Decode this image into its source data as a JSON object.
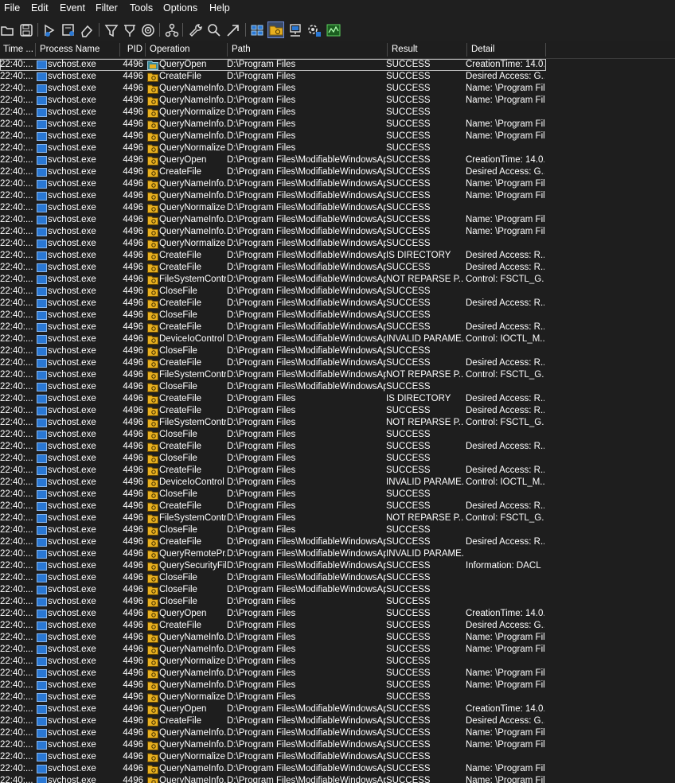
{
  "menu": [
    "File",
    "Edit",
    "Event",
    "Filter",
    "Tools",
    "Options",
    "Help"
  ],
  "toolbar_icons": [
    "open-icon",
    "save-icon",
    "capture-icon",
    "autoscroll-icon",
    "clear-icon",
    "filter-icon",
    "highlight-icon",
    "target-icon",
    "process-tree-icon",
    "find-icon",
    "search-icon",
    "jump-icon",
    "registry-icon",
    "filesystem-icon",
    "network-icon",
    "process-thread-icon",
    "profiling-icon"
  ],
  "columns": {
    "time": "Time ...",
    "process": "Process Name",
    "pid": "PID",
    "operation": "Operation",
    "path": "Path",
    "result": "Result",
    "detail": "Detail"
  },
  "colors": {
    "background": "#1e1e1e",
    "process_icon": "#2a78d4",
    "fs_icon": "#e8b020"
  },
  "rows": [
    {
      "time": "22:40:...",
      "process": "svchost.exe",
      "pid": "4496",
      "op": "QueryOpen",
      "path": "D:\\Program Files",
      "result": "SUCCESS",
      "detail": "CreationTime: 14.0..."
    },
    {
      "time": "22:40:...",
      "process": "svchost.exe",
      "pid": "4496",
      "op": "CreateFile",
      "path": "D:\\Program Files",
      "result": "SUCCESS",
      "detail": "Desired Access: G..."
    },
    {
      "time": "22:40:...",
      "process": "svchost.exe",
      "pid": "4496",
      "op": "QueryNameInfo...",
      "path": "D:\\Program Files",
      "result": "SUCCESS",
      "detail": "Name: \\Program Fil..."
    },
    {
      "time": "22:40:...",
      "process": "svchost.exe",
      "pid": "4496",
      "op": "QueryNameInfo...",
      "path": "D:\\Program Files",
      "result": "SUCCESS",
      "detail": "Name: \\Program Fil..."
    },
    {
      "time": "22:40:...",
      "process": "svchost.exe",
      "pid": "4496",
      "op": "QueryNormalize...",
      "path": "D:\\Program Files",
      "result": "SUCCESS",
      "detail": ""
    },
    {
      "time": "22:40:...",
      "process": "svchost.exe",
      "pid": "4496",
      "op": "QueryNameInfo...",
      "path": "D:\\Program Files",
      "result": "SUCCESS",
      "detail": "Name: \\Program Fil..."
    },
    {
      "time": "22:40:...",
      "process": "svchost.exe",
      "pid": "4496",
      "op": "QueryNameInfo...",
      "path": "D:\\Program Files",
      "result": "SUCCESS",
      "detail": "Name: \\Program Fil..."
    },
    {
      "time": "22:40:...",
      "process": "svchost.exe",
      "pid": "4496",
      "op": "QueryNormalize...",
      "path": "D:\\Program Files",
      "result": "SUCCESS",
      "detail": ""
    },
    {
      "time": "22:40:...",
      "process": "svchost.exe",
      "pid": "4496",
      "op": "QueryOpen",
      "path": "D:\\Program Files\\ModifiableWindowsApps",
      "result": "SUCCESS",
      "detail": "CreationTime: 14.0..."
    },
    {
      "time": "22:40:...",
      "process": "svchost.exe",
      "pid": "4496",
      "op": "CreateFile",
      "path": "D:\\Program Files\\ModifiableWindowsApps",
      "result": "SUCCESS",
      "detail": "Desired Access: G..."
    },
    {
      "time": "22:40:...",
      "process": "svchost.exe",
      "pid": "4496",
      "op": "QueryNameInfo...",
      "path": "D:\\Program Files\\ModifiableWindowsApps",
      "result": "SUCCESS",
      "detail": "Name: \\Program Fil..."
    },
    {
      "time": "22:40:...",
      "process": "svchost.exe",
      "pid": "4496",
      "op": "QueryNameInfo...",
      "path": "D:\\Program Files\\ModifiableWindowsApps",
      "result": "SUCCESS",
      "detail": "Name: \\Program Fil..."
    },
    {
      "time": "22:40:...",
      "process": "svchost.exe",
      "pid": "4496",
      "op": "QueryNormalize...",
      "path": "D:\\Program Files\\ModifiableWindowsApps",
      "result": "SUCCESS",
      "detail": ""
    },
    {
      "time": "22:40:...",
      "process": "svchost.exe",
      "pid": "4496",
      "op": "QueryNameInfo...",
      "path": "D:\\Program Files\\ModifiableWindowsApps",
      "result": "SUCCESS",
      "detail": "Name: \\Program Fil..."
    },
    {
      "time": "22:40:...",
      "process": "svchost.exe",
      "pid": "4496",
      "op": "QueryNameInfo...",
      "path": "D:\\Program Files\\ModifiableWindowsApps",
      "result": "SUCCESS",
      "detail": "Name: \\Program Fil..."
    },
    {
      "time": "22:40:...",
      "process": "svchost.exe",
      "pid": "4496",
      "op": "QueryNormalize...",
      "path": "D:\\Program Files\\ModifiableWindowsApps",
      "result": "SUCCESS",
      "detail": ""
    },
    {
      "time": "22:40:...",
      "process": "svchost.exe",
      "pid": "4496",
      "op": "CreateFile",
      "path": "D:\\Program Files\\ModifiableWindowsApps",
      "result": "IS DIRECTORY",
      "detail": "Desired Access: R..."
    },
    {
      "time": "22:40:...",
      "process": "svchost.exe",
      "pid": "4496",
      "op": "CreateFile",
      "path": "D:\\Program Files\\ModifiableWindowsApps",
      "result": "SUCCESS",
      "detail": "Desired Access: R..."
    },
    {
      "time": "22:40:...",
      "process": "svchost.exe",
      "pid": "4496",
      "op": "FileSystemControl",
      "path": "D:\\Program Files\\ModifiableWindowsApps",
      "result": "NOT REPARSE P...",
      "detail": "Control: FSCTL_G..."
    },
    {
      "time": "22:40:...",
      "process": "svchost.exe",
      "pid": "4496",
      "op": "CloseFile",
      "path": "D:\\Program Files\\ModifiableWindowsApps",
      "result": "SUCCESS",
      "detail": ""
    },
    {
      "time": "22:40:...",
      "process": "svchost.exe",
      "pid": "4496",
      "op": "CreateFile",
      "path": "D:\\Program Files\\ModifiableWindowsApps",
      "result": "SUCCESS",
      "detail": "Desired Access: R..."
    },
    {
      "time": "22:40:...",
      "process": "svchost.exe",
      "pid": "4496",
      "op": "CloseFile",
      "path": "D:\\Program Files\\ModifiableWindowsApps",
      "result": "SUCCESS",
      "detail": ""
    },
    {
      "time": "22:40:...",
      "process": "svchost.exe",
      "pid": "4496",
      "op": "CreateFile",
      "path": "D:\\Program Files\\ModifiableWindowsApps",
      "result": "SUCCESS",
      "detail": "Desired Access: R..."
    },
    {
      "time": "22:40:...",
      "process": "svchost.exe",
      "pid": "4496",
      "op": "DeviceIoControl",
      "path": "D:\\Program Files\\ModifiableWindowsApps",
      "result": "INVALID PARAME...",
      "detail": "Control: IOCTL_M..."
    },
    {
      "time": "22:40:...",
      "process": "svchost.exe",
      "pid": "4496",
      "op": "CloseFile",
      "path": "D:\\Program Files\\ModifiableWindowsApps",
      "result": "SUCCESS",
      "detail": ""
    },
    {
      "time": "22:40:...",
      "process": "svchost.exe",
      "pid": "4496",
      "op": "CreateFile",
      "path": "D:\\Program Files\\ModifiableWindowsApps",
      "result": "SUCCESS",
      "detail": "Desired Access: R..."
    },
    {
      "time": "22:40:...",
      "process": "svchost.exe",
      "pid": "4496",
      "op": "FileSystemControl",
      "path": "D:\\Program Files\\ModifiableWindowsApps",
      "result": "NOT REPARSE P...",
      "detail": "Control: FSCTL_G..."
    },
    {
      "time": "22:40:...",
      "process": "svchost.exe",
      "pid": "4496",
      "op": "CloseFile",
      "path": "D:\\Program Files\\ModifiableWindowsApps",
      "result": "SUCCESS",
      "detail": ""
    },
    {
      "time": "22:40:...",
      "process": "svchost.exe",
      "pid": "4496",
      "op": "CreateFile",
      "path": "D:\\Program Files",
      "result": "IS DIRECTORY",
      "detail": "Desired Access: R..."
    },
    {
      "time": "22:40:...",
      "process": "svchost.exe",
      "pid": "4496",
      "op": "CreateFile",
      "path": "D:\\Program Files",
      "result": "SUCCESS",
      "detail": "Desired Access: R..."
    },
    {
      "time": "22:40:...",
      "process": "svchost.exe",
      "pid": "4496",
      "op": "FileSystemControl",
      "path": "D:\\Program Files",
      "result": "NOT REPARSE P...",
      "detail": "Control: FSCTL_G..."
    },
    {
      "time": "22:40:...",
      "process": "svchost.exe",
      "pid": "4496",
      "op": "CloseFile",
      "path": "D:\\Program Files",
      "result": "SUCCESS",
      "detail": ""
    },
    {
      "time": "22:40:...",
      "process": "svchost.exe",
      "pid": "4496",
      "op": "CreateFile",
      "path": "D:\\Program Files",
      "result": "SUCCESS",
      "detail": "Desired Access: R..."
    },
    {
      "time": "22:40:...",
      "process": "svchost.exe",
      "pid": "4496",
      "op": "CloseFile",
      "path": "D:\\Program Files",
      "result": "SUCCESS",
      "detail": ""
    },
    {
      "time": "22:40:...",
      "process": "svchost.exe",
      "pid": "4496",
      "op": "CreateFile",
      "path": "D:\\Program Files",
      "result": "SUCCESS",
      "detail": "Desired Access: R..."
    },
    {
      "time": "22:40:...",
      "process": "svchost.exe",
      "pid": "4496",
      "op": "DeviceIoControl",
      "path": "D:\\Program Files",
      "result": "INVALID PARAME...",
      "detail": "Control: IOCTL_M..."
    },
    {
      "time": "22:40:...",
      "process": "svchost.exe",
      "pid": "4496",
      "op": "CloseFile",
      "path": "D:\\Program Files",
      "result": "SUCCESS",
      "detail": ""
    },
    {
      "time": "22:40:...",
      "process": "svchost.exe",
      "pid": "4496",
      "op": "CreateFile",
      "path": "D:\\Program Files",
      "result": "SUCCESS",
      "detail": "Desired Access: R..."
    },
    {
      "time": "22:40:...",
      "process": "svchost.exe",
      "pid": "4496",
      "op": "FileSystemControl",
      "path": "D:\\Program Files",
      "result": "NOT REPARSE P...",
      "detail": "Control: FSCTL_G..."
    },
    {
      "time": "22:40:...",
      "process": "svchost.exe",
      "pid": "4496",
      "op": "CloseFile",
      "path": "D:\\Program Files",
      "result": "SUCCESS",
      "detail": ""
    },
    {
      "time": "22:40:...",
      "process": "svchost.exe",
      "pid": "4496",
      "op": "CreateFile",
      "path": "D:\\Program Files\\ModifiableWindowsApps",
      "result": "SUCCESS",
      "detail": "Desired Access: R..."
    },
    {
      "time": "22:40:...",
      "process": "svchost.exe",
      "pid": "4496",
      "op": "QueryRemotePr...",
      "path": "D:\\Program Files\\ModifiableWindowsApps",
      "result": "INVALID PARAME...",
      "detail": ""
    },
    {
      "time": "22:40:...",
      "process": "svchost.exe",
      "pid": "4496",
      "op": "QuerySecurityFile",
      "path": "D:\\Program Files\\ModifiableWindowsApps",
      "result": "SUCCESS",
      "detail": "Information: DACL"
    },
    {
      "time": "22:40:...",
      "process": "svchost.exe",
      "pid": "4496",
      "op": "CloseFile",
      "path": "D:\\Program Files\\ModifiableWindowsApps",
      "result": "SUCCESS",
      "detail": ""
    },
    {
      "time": "22:40:...",
      "process": "svchost.exe",
      "pid": "4496",
      "op": "CloseFile",
      "path": "D:\\Program Files\\ModifiableWindowsApps",
      "result": "SUCCESS",
      "detail": ""
    },
    {
      "time": "22:40:...",
      "process": "svchost.exe",
      "pid": "4496",
      "op": "CloseFile",
      "path": "D:\\Program Files",
      "result": "SUCCESS",
      "detail": ""
    },
    {
      "time": "22:40:...",
      "process": "svchost.exe",
      "pid": "4496",
      "op": "QueryOpen",
      "path": "D:\\Program Files",
      "result": "SUCCESS",
      "detail": "CreationTime: 14.0..."
    },
    {
      "time": "22:40:...",
      "process": "svchost.exe",
      "pid": "4496",
      "op": "CreateFile",
      "path": "D:\\Program Files",
      "result": "SUCCESS",
      "detail": "Desired Access: G..."
    },
    {
      "time": "22:40:...",
      "process": "svchost.exe",
      "pid": "4496",
      "op": "QueryNameInfo...",
      "path": "D:\\Program Files",
      "result": "SUCCESS",
      "detail": "Name: \\Program Fil..."
    },
    {
      "time": "22:40:...",
      "process": "svchost.exe",
      "pid": "4496",
      "op": "QueryNameInfo...",
      "path": "D:\\Program Files",
      "result": "SUCCESS",
      "detail": "Name: \\Program Fil..."
    },
    {
      "time": "22:40:...",
      "process": "svchost.exe",
      "pid": "4496",
      "op": "QueryNormalize...",
      "path": "D:\\Program Files",
      "result": "SUCCESS",
      "detail": ""
    },
    {
      "time": "22:40:...",
      "process": "svchost.exe",
      "pid": "4496",
      "op": "QueryNameInfo...",
      "path": "D:\\Program Files",
      "result": "SUCCESS",
      "detail": "Name: \\Program Fil..."
    },
    {
      "time": "22:40:...",
      "process": "svchost.exe",
      "pid": "4496",
      "op": "QueryNameInfo...",
      "path": "D:\\Program Files",
      "result": "SUCCESS",
      "detail": "Name: \\Program Fil..."
    },
    {
      "time": "22:40:...",
      "process": "svchost.exe",
      "pid": "4496",
      "op": "QueryNormalize...",
      "path": "D:\\Program Files",
      "result": "SUCCESS",
      "detail": ""
    },
    {
      "time": "22:40:...",
      "process": "svchost.exe",
      "pid": "4496",
      "op": "QueryOpen",
      "path": "D:\\Program Files\\ModifiableWindowsApps",
      "result": "SUCCESS",
      "detail": "CreationTime: 14.0..."
    },
    {
      "time": "22:40:...",
      "process": "svchost.exe",
      "pid": "4496",
      "op": "CreateFile",
      "path": "D:\\Program Files\\ModifiableWindowsApps",
      "result": "SUCCESS",
      "detail": "Desired Access: G..."
    },
    {
      "time": "22:40:...",
      "process": "svchost.exe",
      "pid": "4496",
      "op": "QueryNameInfo...",
      "path": "D:\\Program Files\\ModifiableWindowsApps",
      "result": "SUCCESS",
      "detail": "Name: \\Program Fil..."
    },
    {
      "time": "22:40:...",
      "process": "svchost.exe",
      "pid": "4496",
      "op": "QueryNameInfo...",
      "path": "D:\\Program Files\\ModifiableWindowsApps",
      "result": "SUCCESS",
      "detail": "Name: \\Program Fil..."
    },
    {
      "time": "22:40:...",
      "process": "svchost.exe",
      "pid": "4496",
      "op": "QueryNormalize...",
      "path": "D:\\Program Files\\ModifiableWindowsApps",
      "result": "SUCCESS",
      "detail": ""
    },
    {
      "time": "22:40:...",
      "process": "svchost.exe",
      "pid": "4496",
      "op": "QueryNameInfo...",
      "path": "D:\\Program Files\\ModifiableWindowsApps",
      "result": "SUCCESS",
      "detail": "Name: \\Program Fil..."
    },
    {
      "time": "22:40:...",
      "process": "svchost.exe",
      "pid": "4496",
      "op": "QueryNameInfo...",
      "path": "D:\\Program Files\\ModifiableWindowsApps",
      "result": "SUCCESS",
      "detail": "Name: \\Program Fil..."
    }
  ]
}
